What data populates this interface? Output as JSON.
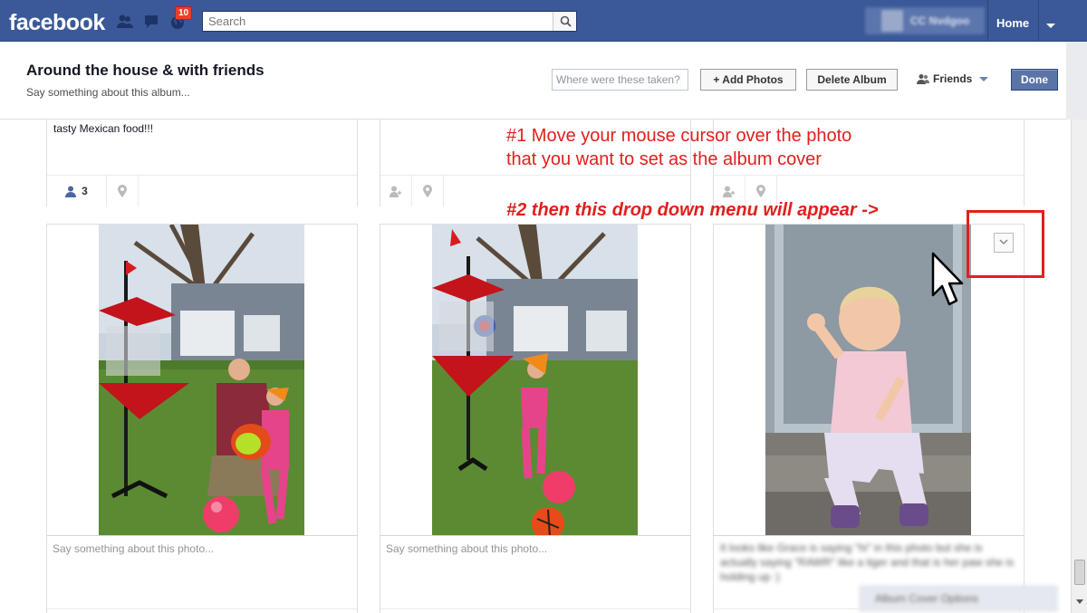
{
  "topbar": {
    "logo": "facebook",
    "notification_count": "10",
    "search_placeholder": "Search",
    "home_label": "Home"
  },
  "album": {
    "title": "Around the house & with friends",
    "description_placeholder": "Say something about this album...",
    "location_placeholder": "Where were these taken?",
    "add_photos_label": "+ Add Photos",
    "delete_album_label": "Delete Album",
    "privacy_label": "Friends",
    "done_label": "Done"
  },
  "top_row": {
    "caption_visible": "tasty Mexican food!!!",
    "tag_count": "3"
  },
  "photos": [
    {
      "caption_placeholder": "Say something about this photo..."
    },
    {
      "caption_placeholder": "Say something about this photo..."
    },
    {
      "caption_placeholder": ""
    }
  ],
  "annotations": {
    "step1_line1": "#1 Move your mouse cursor over the photo",
    "step1_line2": "that you want to set as the album cover",
    "step2": "#2 then this drop down menu will appear ->"
  },
  "colors": {
    "brand": "#3b5998",
    "annotation": "#e0201c",
    "done_button": "#5b74a8"
  }
}
